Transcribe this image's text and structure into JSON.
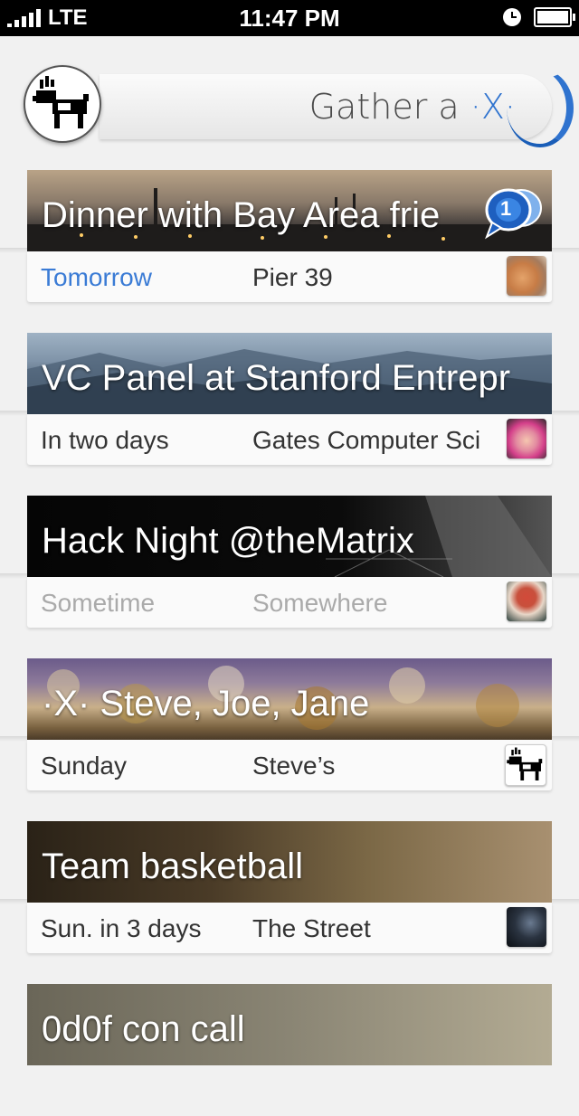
{
  "status_bar": {
    "carrier": "LTE",
    "time": "11:47 PM"
  },
  "header": {
    "gather_prefix": "Gather a",
    "gather_x": "·X·"
  },
  "events": [
    {
      "title": "Dinner with Bay Area frie",
      "time": "Tomorrow",
      "place": "Pier 39",
      "comments": "1"
    },
    {
      "title": "VC Panel at Stanford Entrepr",
      "time": "In two days",
      "place": "Gates Computer Sci"
    },
    {
      "title": "Hack Night @theMatrix",
      "time": "Sometime",
      "place": "Somewhere"
    },
    {
      "title": "·X· Steve, Joe, Jane",
      "time": "Sunday",
      "place": "Steve’s"
    },
    {
      "title": "Team basketball",
      "time": "Sun. in 3 days",
      "place": "The Street"
    },
    {
      "title": "0d0f con call"
    }
  ],
  "colors": {
    "accent": "#2f73cf",
    "status_bar": "#000000",
    "background": "#f1f1f1"
  }
}
